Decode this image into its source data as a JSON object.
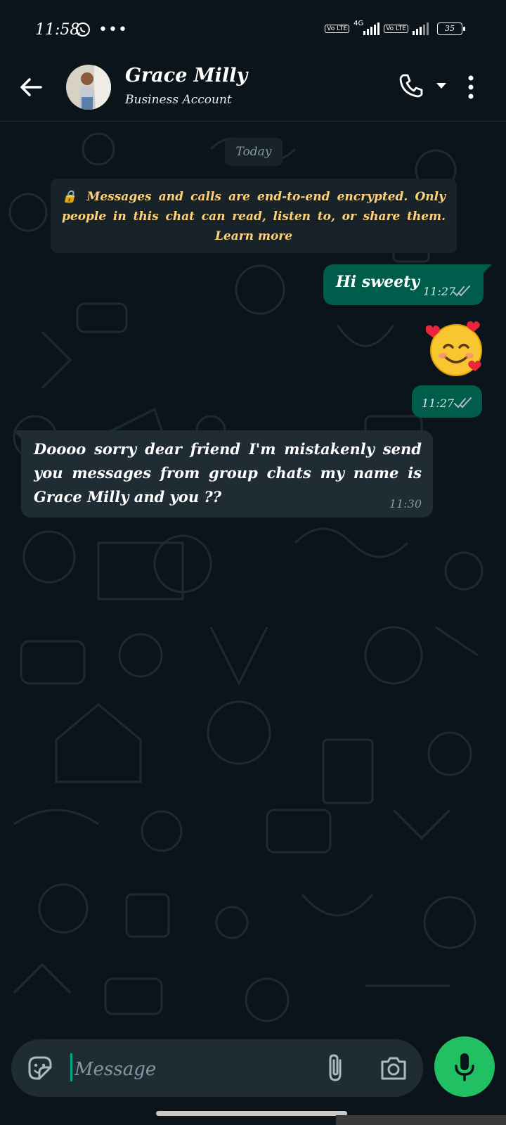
{
  "status_bar": {
    "time": "11:58",
    "network": "4G",
    "volte1": "Vo LTE",
    "volte2": "Vo LTE",
    "battery": "35"
  },
  "header": {
    "contact_name": "Grace  Milly",
    "subtitle": "Business  Account",
    "icons": [
      "back-arrow-icon",
      "phone-icon",
      "caret-down-icon",
      "more-vertical-icon"
    ]
  },
  "chat": {
    "date_chip": "Today",
    "encryption_notice": "Messages  and  calls  are  end-to-end  encrypted.  Only  people  in  this  chat  can  read,  listen  to,  or  share  them.",
    "encryption_link": "Learn more",
    "messages": [
      {
        "direction": "out",
        "text": "Hi  sweety",
        "time": "11:27",
        "status": "read"
      },
      {
        "direction": "out",
        "emoji": "smiling-face-with-hearts",
        "time": "11:27",
        "status": "read"
      },
      {
        "direction": "in",
        "text": "Doooo  sorry  dear  friend  I'm  mistakenly  send  you  messages  from  group  chats  my  name  is   Grace  Milly  and  you  ??",
        "time": "11:30"
      }
    ]
  },
  "composer": {
    "placeholder": "Message",
    "icons": [
      "sticker-icon",
      "attach-icon",
      "camera-icon",
      "mic-icon"
    ]
  },
  "colors": {
    "background": "#0b141a",
    "outgoing_bubble": "#005c4b",
    "incoming_bubble": "#202c33",
    "accent_green": "#21c063",
    "encryption_text": "#ffd279"
  }
}
